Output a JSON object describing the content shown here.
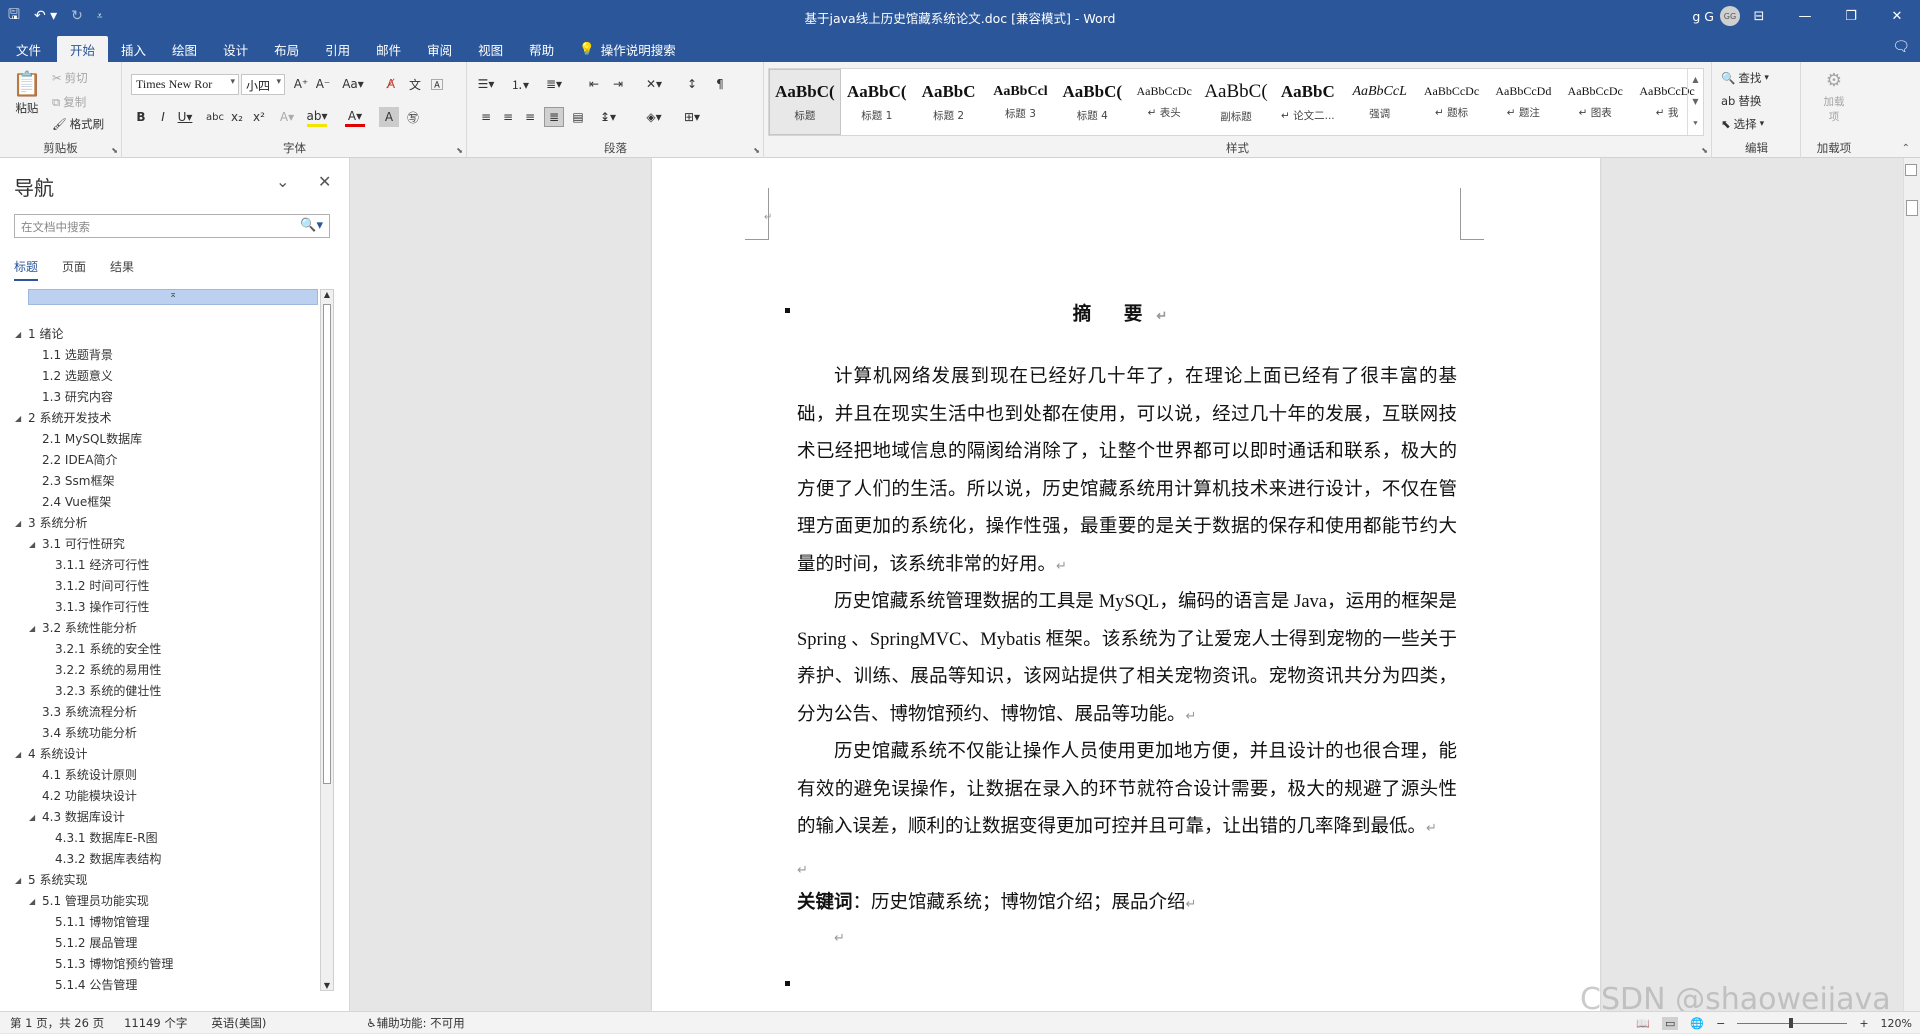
{
  "titlebar": {
    "title": "基于java线上历史馆藏系统论文.doc  [兼容模式]  -  Word",
    "user_name": "g G",
    "avatar_initials": "GG",
    "accent": "#2b579a"
  },
  "menubar": {
    "tabs": [
      "文件",
      "开始",
      "插入",
      "绘图",
      "设计",
      "布局",
      "引用",
      "邮件",
      "审阅",
      "视图",
      "帮助"
    ],
    "active_tab": "开始",
    "tell_me": "操作说明搜索"
  },
  "ribbon": {
    "clipboard": {
      "label": "剪贴板",
      "paste": "粘贴",
      "cut": "剪切",
      "copy": "复制",
      "format_painter": "格式刷"
    },
    "font": {
      "label": "字体",
      "font_name": "Times New Ror",
      "font_size": "小四"
    },
    "paragraph": {
      "label": "段落"
    },
    "styles": {
      "label": "样式",
      "items": [
        {
          "preview": "AaBbC(",
          "name": "标题"
        },
        {
          "preview": "AaBbC(",
          "name": "标题 1"
        },
        {
          "preview": "AaBbC",
          "name": "标题 2"
        },
        {
          "preview": "AaBbCcl",
          "name": "标题 3"
        },
        {
          "preview": "AaBbC(",
          "name": "标题 4"
        },
        {
          "preview": "AaBbCcDc",
          "name": "↵ 表头"
        },
        {
          "preview": "AaBbC(",
          "name": "副标题"
        },
        {
          "preview": "AaBbC",
          "name": "↵ 论文二..."
        },
        {
          "preview": "AaBbCcL",
          "name": "强调"
        },
        {
          "preview": "AaBbCcDc",
          "name": "↵ 题标"
        },
        {
          "preview": "AaBbCcDd",
          "name": "↵ 题注"
        },
        {
          "preview": "AaBbCcDc",
          "name": "↵ 图表"
        },
        {
          "preview": "AaBbCcDc",
          "name": "↵ 我"
        }
      ]
    },
    "editing": {
      "label": "编辑",
      "find": "查找",
      "replace": "替换",
      "select": "选择"
    },
    "addins": {
      "label": "加载项",
      "button": "加载项"
    }
  },
  "nav": {
    "title": "导航",
    "search_placeholder": "在文档中搜索",
    "tabs": [
      "标题",
      "页面",
      "结果"
    ],
    "active_tab": "标题",
    "items": [
      {
        "text": "1 绪论",
        "level": 1,
        "expanded": true
      },
      {
        "text": "1.1 选题背景",
        "level": 2
      },
      {
        "text": "1.2 选题意义",
        "level": 2
      },
      {
        "text": "1.3 研究内容",
        "level": 2
      },
      {
        "text": "2 系统开发技术",
        "level": 1,
        "expanded": true
      },
      {
        "text": "2.1 MySQL数据库",
        "level": 2
      },
      {
        "text": "2.2 IDEA简介",
        "level": 2
      },
      {
        "text": "2.3 Ssm框架",
        "level": 2
      },
      {
        "text": "2.4 Vue框架",
        "level": 2
      },
      {
        "text": "3 系统分析",
        "level": 1,
        "expanded": true
      },
      {
        "text": "3.1 可行性研究",
        "level": 2,
        "expanded": true
      },
      {
        "text": "3.1.1 经济可行性",
        "level": 3
      },
      {
        "text": "3.1.2 时间可行性",
        "level": 3
      },
      {
        "text": "3.1.3 操作可行性",
        "level": 3
      },
      {
        "text": "3.2 系统性能分析",
        "level": 2,
        "expanded": true
      },
      {
        "text": "3.2.1 系统的安全性",
        "level": 3
      },
      {
        "text": "3.2.2 系统的易用性",
        "level": 3
      },
      {
        "text": "3.2.3 系统的健壮性",
        "level": 3
      },
      {
        "text": "3.3 系统流程分析",
        "level": 2
      },
      {
        "text": "3.4 系统功能分析",
        "level": 2
      },
      {
        "text": "4 系统设计",
        "level": 1,
        "expanded": true
      },
      {
        "text": "4.1 系统设计原则",
        "level": 2
      },
      {
        "text": "4.2 功能模块设计",
        "level": 2
      },
      {
        "text": "4.3 数据库设计",
        "level": 2,
        "expanded": true
      },
      {
        "text": "4.3.1 数据库E-R图",
        "level": 3
      },
      {
        "text": "4.3.2 数据库表结构",
        "level": 3
      },
      {
        "text": "5 系统实现",
        "level": 1,
        "expanded": true
      },
      {
        "text": "5.1 管理员功能实现",
        "level": 2,
        "expanded": true
      },
      {
        "text": "5.1.1 博物馆管理",
        "level": 3
      },
      {
        "text": "5.1.2 展品管理",
        "level": 3
      },
      {
        "text": "5.1.3 博物馆预约管理",
        "level": 3
      },
      {
        "text": "5.1.4 公告管理",
        "level": 3
      }
    ]
  },
  "document": {
    "heading": "摘  要",
    "paragraphs": [
      "计算机网络发展到现在已经好几十年了，在理论上面已经有了很丰富的基础，并且在现实生活中也到处都在使用，可以说，经过几十年的发展，互联网技术已经把地域信息的隔阂给消除了，让整个世界都可以即时通话和联系，极大的方便了人们的生活。所以说，历史馆藏系统用计算机技术来进行设计，不仅在管理方面更加的系统化，操作性强，最重要的是关于数据的保存和使用都能节约大量的时间，该系统非常的好用。",
      "历史馆藏系统管理数据的工具是 MySQL，编码的语言是 Java，运用的框架是 Spring 、SpringMVC、Mybatis 框架。该系统为了让爱宠人士得到宠物的一些关于养护、训练、展品等知识，该网站提供了相关宠物资讯。宠物资讯共分为四类，分为公告、博物馆预约、博物馆、展品等功能。",
      "历史馆藏系统不仅能让操作人员使用更加地方便，并且设计的也很合理，能有效的避免误操作，让数据在录入的环节就符合设计需要，极大的规避了源头性的输入误差，顺利的让数据变得更加可控并且可靠，让出错的几率降到最低。"
    ],
    "keywords_label": "关键词",
    "keywords": "：历史馆藏系统；博物馆介绍；展品介绍"
  },
  "statusbar": {
    "page": "第 1 页，共 26 页",
    "words": "11149 个字",
    "language": "英语(美国)",
    "accessibility": "辅助功能: 不可用",
    "zoom": "120%"
  },
  "watermark": "CSDN @shaoweijava"
}
